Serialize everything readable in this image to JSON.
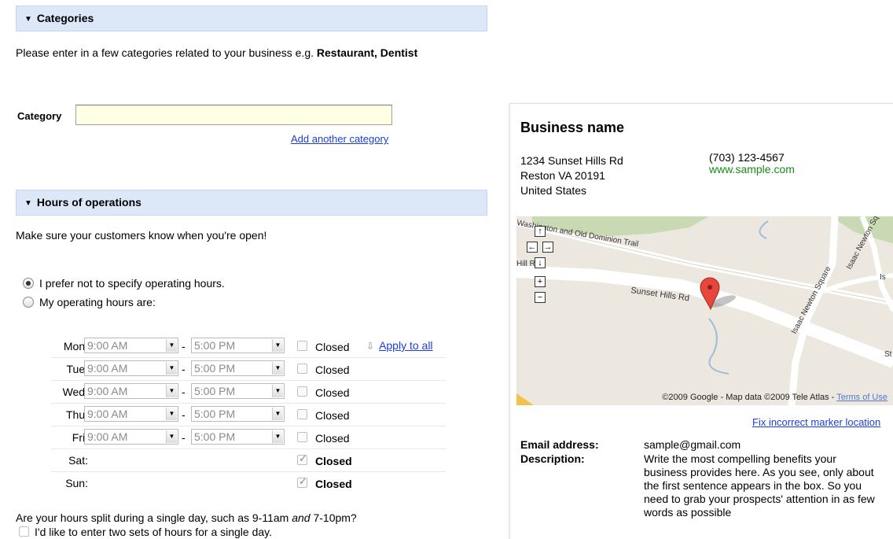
{
  "categories_section": {
    "title": "Categories",
    "intro": "Please enter in a few categories related to your business e.g. ",
    "intro_bold": "Restaurant, Dentist",
    "category_label": "Category",
    "category_value": "",
    "add_link": "Add another category"
  },
  "hours_section": {
    "title": "Hours of operations",
    "intro": "Make sure your customers know when you're open!",
    "option_none": "I prefer not to specify operating hours.",
    "option_specify": "My operating hours are:",
    "selected_option": "none",
    "apply_all": "Apply to all",
    "rows": [
      {
        "day": "Mon:",
        "open": "9:00 AM",
        "close": "5:00 PM",
        "closed": false,
        "closed_label": "Closed"
      },
      {
        "day": "Tue:",
        "open": "9:00 AM",
        "close": "5:00 PM",
        "closed": false,
        "closed_label": "Closed"
      },
      {
        "day": "Wed:",
        "open": "9:00 AM",
        "close": "5:00 PM",
        "closed": false,
        "closed_label": "Closed"
      },
      {
        "day": "Thu:",
        "open": "9:00 AM",
        "close": "5:00 PM",
        "closed": false,
        "closed_label": "Closed"
      },
      {
        "day": "Fri:",
        "open": "9:00 AM",
        "close": "5:00 PM",
        "closed": false,
        "closed_label": "Closed"
      },
      {
        "day": "Sat:",
        "closed": true,
        "closed_label": "Closed"
      },
      {
        "day": "Sun:",
        "closed": true,
        "closed_label": "Closed"
      }
    ],
    "split_question_pre": "Are your hours split during a single day, such as 9-11am ",
    "split_question_and": "and",
    "split_question_post": " 7-10pm?",
    "split_option": "I'd like to enter two sets of hours for a single day."
  },
  "preview": {
    "business_name": "Business name",
    "address_line1": "1234 Sunset Hills Rd",
    "address_line2": "Reston VA 20191",
    "address_line3": "United States",
    "phone": "(703) 123-4567",
    "website": "www.sample.com",
    "map": {
      "road_labels": [
        "Washington and Old Dominion Trail",
        "Sunset Hills Rd",
        "Isaac Newton Square",
        "Isaac Newton Sq",
        "Is",
        "St",
        "Hill Rd"
      ],
      "copyright": "©2009 Google - Map data ©2009 Tele Atlas - ",
      "terms": "Terms of Use",
      "marker_color": "#e8453c"
    },
    "fix_marker": "Fix incorrect marker location",
    "email_label": "Email address:",
    "email": "sample@gmail.com",
    "description_label": "Description:",
    "description": "Write the most compelling benefits your business provides here. As you see, only about the first sentence appears in the box. So you need to grab your prospects' attention in as few words as possible"
  }
}
